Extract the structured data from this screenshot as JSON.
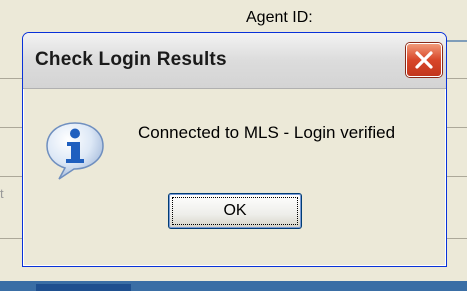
{
  "background": {
    "agent_id_label": "Agent ID:",
    "left_stub_text": "t"
  },
  "dialog": {
    "title": "Check Login Results",
    "close_icon": "close-icon",
    "info_icon": "info-icon",
    "message": "Connected to MLS - Login verified",
    "ok_label": "OK"
  },
  "colors": {
    "title_bar": "#d4d4d4",
    "close_button": "#d8472a",
    "info_icon_blue": "#1f5fbf",
    "taskbar": "#3a6ea5"
  }
}
